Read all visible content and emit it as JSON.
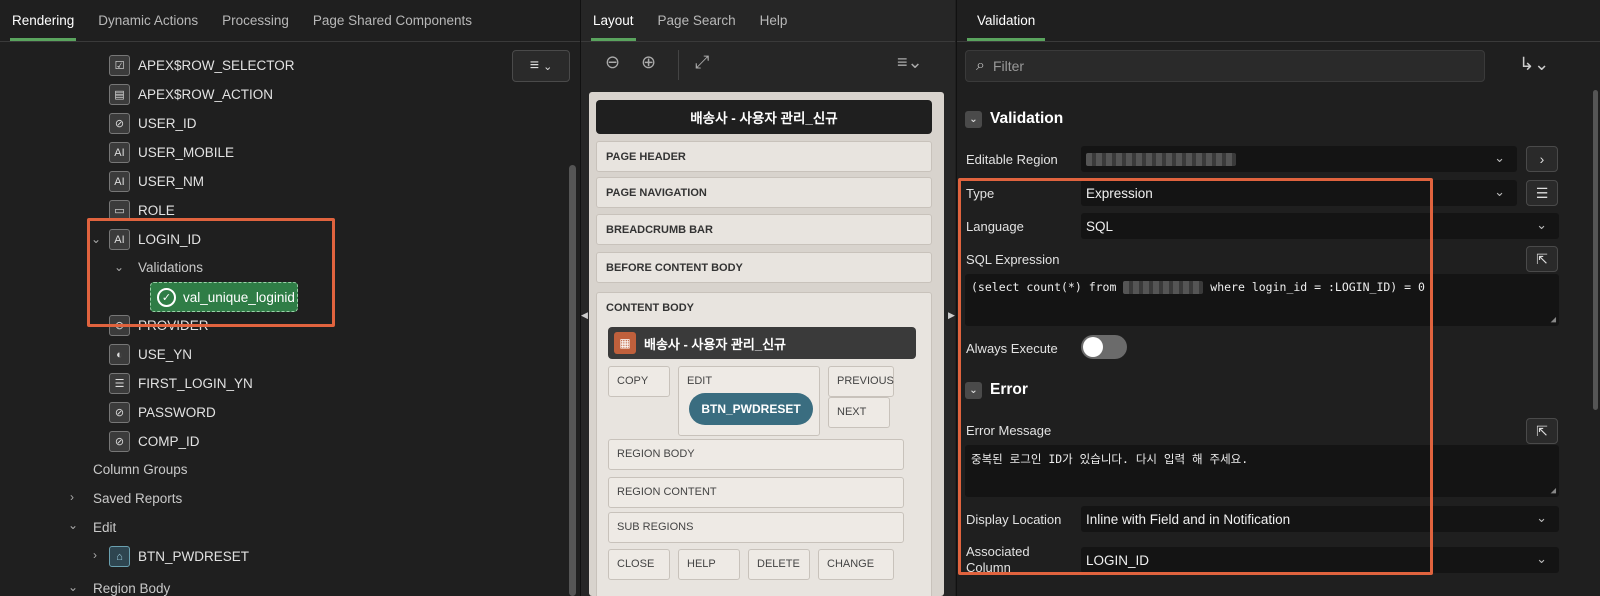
{
  "left": {
    "tabs": [
      {
        "label": "Rendering",
        "active": true
      },
      {
        "label": "Dynamic Actions",
        "active": false
      },
      {
        "label": "Processing",
        "active": false
      },
      {
        "label": "Page Shared Components",
        "active": false
      }
    ],
    "tree": [
      {
        "label": "APEX$ROW_SELECTOR",
        "icon": "checkbox-column-icon"
      },
      {
        "label": "APEX$ROW_ACTION",
        "icon": "row-action-icon"
      },
      {
        "label": "USER_ID",
        "icon": "hidden-column-icon"
      },
      {
        "label": "USER_MOBILE",
        "icon": "text-column-icon"
      },
      {
        "label": "USER_NM",
        "icon": "text-column-icon"
      },
      {
        "label": "ROLE",
        "icon": "select-column-icon"
      },
      {
        "label": "LOGIN_ID",
        "icon": "text-column-icon"
      },
      {
        "label": "Validations",
        "icon": ""
      },
      {
        "label": "val_unique_loginid",
        "icon": "validation-check-icon"
      },
      {
        "label": "PROVIDER",
        "icon": "hidden-column-icon"
      },
      {
        "label": "USE_YN",
        "icon": "switch-column-icon"
      },
      {
        "label": "FIRST_LOGIN_YN",
        "icon": "radio-column-icon"
      },
      {
        "label": "PASSWORD",
        "icon": "hidden-column-icon"
      },
      {
        "label": "COMP_ID",
        "icon": "hidden-column-icon"
      },
      {
        "label": "Column Groups",
        "icon": ""
      },
      {
        "label": "Saved Reports",
        "icon": ""
      },
      {
        "label": "Edit",
        "icon": ""
      },
      {
        "label": "BTN_PWDRESET",
        "icon": "button-icon"
      },
      {
        "label": "Region Body",
        "icon": ""
      }
    ]
  },
  "middle": {
    "tabs": [
      {
        "label": "Layout",
        "active": true
      },
      {
        "label": "Page Search",
        "active": false
      },
      {
        "label": "Help",
        "active": false
      }
    ],
    "page_title": "배송사 - 사용자 관리_신규",
    "slots": [
      "PAGE HEADER",
      "PAGE NAVIGATION",
      "BREADCRUMB BAR",
      "BEFORE CONTENT BODY"
    ],
    "content_body": "CONTENT BODY",
    "region_title": "배송사 - 사용자 관리_신규",
    "button_slots": {
      "copy": "COPY",
      "edit": "EDIT",
      "previous": "PREVIOUS",
      "next": "NEXT",
      "region_body": "REGION BODY",
      "region_content": "REGION CONTENT",
      "sub_regions": "SUB REGIONS",
      "close": "CLOSE",
      "help": "HELP",
      "delete": "DELETE",
      "change": "CHANGE"
    },
    "button": "BTN_PWDRESET"
  },
  "right": {
    "tabs": [
      {
        "label": "Validation",
        "active": true
      }
    ],
    "filter_placeholder": "Filter",
    "validation_section": "Validation",
    "editable_region_label": "Editable Region",
    "type_label": "Type",
    "type_value": "Expression",
    "language_label": "Language",
    "language_value": "SQL",
    "sql_expression_label": "SQL Expression",
    "sql_expression_pre": "(select count(*) from",
    "sql_expression_post": "where login_id = :LOGIN_ID) = 0",
    "always_execute_label": "Always Execute",
    "always_execute_on": false,
    "error_section": "Error",
    "error_message_label": "Error Message",
    "error_message_value": "중복된 로그인 ID가 있습니다. 다시 입력 해 주세요.",
    "display_location_label": "Display Location",
    "display_location_value": "Inline with Field and in Notification",
    "associated_column_label": "Associated Column",
    "associated_column_value": "LOGIN_ID"
  },
  "colors": {
    "highlight": "#e0633e",
    "active_tab": "#5aa45e",
    "validation_chip": "#2f7d46",
    "button_pill": "#3a6d80"
  }
}
